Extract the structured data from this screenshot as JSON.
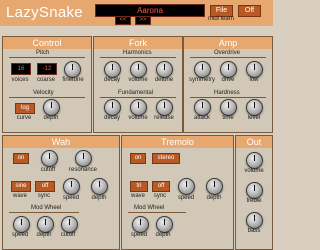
{
  "app": {
    "title": "LazySnake",
    "preset": "Aarona",
    "file_label": "File",
    "power_label": "Off",
    "midi_learn_label": "midi learn"
  },
  "control": {
    "title": "Control",
    "pitch_header": "Pitch",
    "voices_value": "16",
    "coarse_value": "-12",
    "voices_label": "voices",
    "coarse_label": "coarse",
    "finetune_label": "finetune",
    "velocity_header": "Velocity",
    "curve_value": "log",
    "curve_label": "curve",
    "depth_label": "depth"
  },
  "fork": {
    "title": "Fork",
    "harmonics_header": "Harmonics",
    "harmonics_labels": [
      "decay",
      "volume",
      "detune"
    ],
    "fundamental_header": "Fundamental",
    "fundamental_labels": [
      "decay",
      "volume",
      "release"
    ]
  },
  "amp": {
    "title": "Amp",
    "overdrive_header": "Overdrive",
    "overdrive_labels": [
      "symmetry",
      "drive",
      "low"
    ],
    "hardness_header": "Hardness",
    "hardness_labels": [
      "attack",
      "time",
      "level"
    ]
  },
  "wah": {
    "title": "Wah",
    "on_value": "on",
    "cutoff_label": "cutoff",
    "resonance_label": "resonance",
    "wave_value": "sine",
    "sync_value": "off",
    "wave_label": "wave",
    "sync_label": "sync",
    "speed_label": "speed",
    "depth_label": "depth",
    "modwheel_header": "Mod Wheel",
    "modwheel_labels": [
      "speed",
      "depth",
      "cutoff"
    ]
  },
  "tremolo": {
    "title": "Tremolo",
    "on_value": "on",
    "stereo_value": "stereo",
    "wave_value": "tri",
    "sync_value": "off",
    "wave_label": "wave",
    "sync_label": "sync",
    "speed_label": "speed",
    "depth_label": "depth",
    "modwheel_header": "Mod Wheel",
    "modwheel_labels": [
      "speed",
      "depth"
    ]
  },
  "out": {
    "title": "Out",
    "labels": [
      "volume",
      "treble",
      "bass"
    ]
  }
}
